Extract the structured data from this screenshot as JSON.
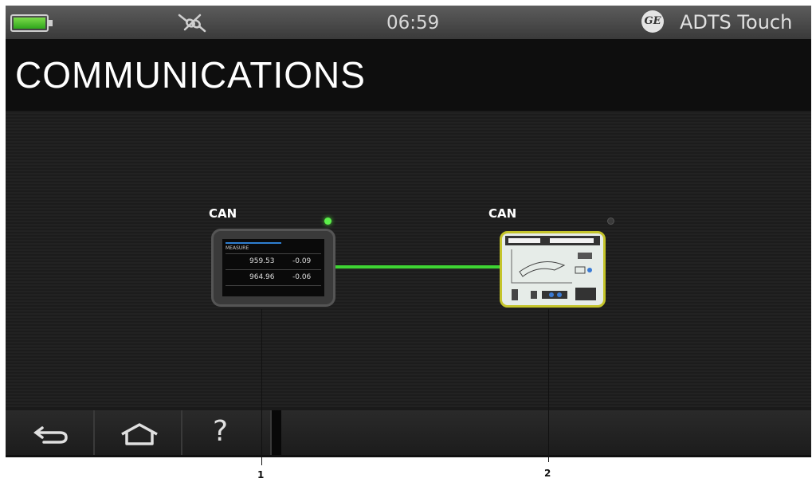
{
  "status_bar": {
    "time": "06:59",
    "app_name": "ADTS Touch",
    "battery_icon": "battery-full-icon",
    "connection_icon": "plug-disconnected-icon",
    "logo": "ge-logo",
    "logo_text": "GE",
    "battery_color": "#3fbf2a"
  },
  "page": {
    "title": "COMMUNICATIONS"
  },
  "devices": [
    {
      "bus_label": "CAN",
      "status": "connected",
      "led_color": "#5cf04a",
      "screen": {
        "header": "MEASURE",
        "readings": [
          {
            "left": "959.53",
            "right": "-0.09"
          },
          {
            "left": "964.96",
            "right": "-0.06"
          }
        ]
      }
    },
    {
      "bus_label": "CAN",
      "status": "disconnected",
      "led_color": "#3a3a3a"
    }
  ],
  "link_color": "#3ed433",
  "navigation": {
    "back_icon": "back-arrow-icon",
    "home_icon": "home-icon",
    "help_icon": "help-icon",
    "help_glyph": "?"
  },
  "callouts": [
    "1",
    "2"
  ]
}
